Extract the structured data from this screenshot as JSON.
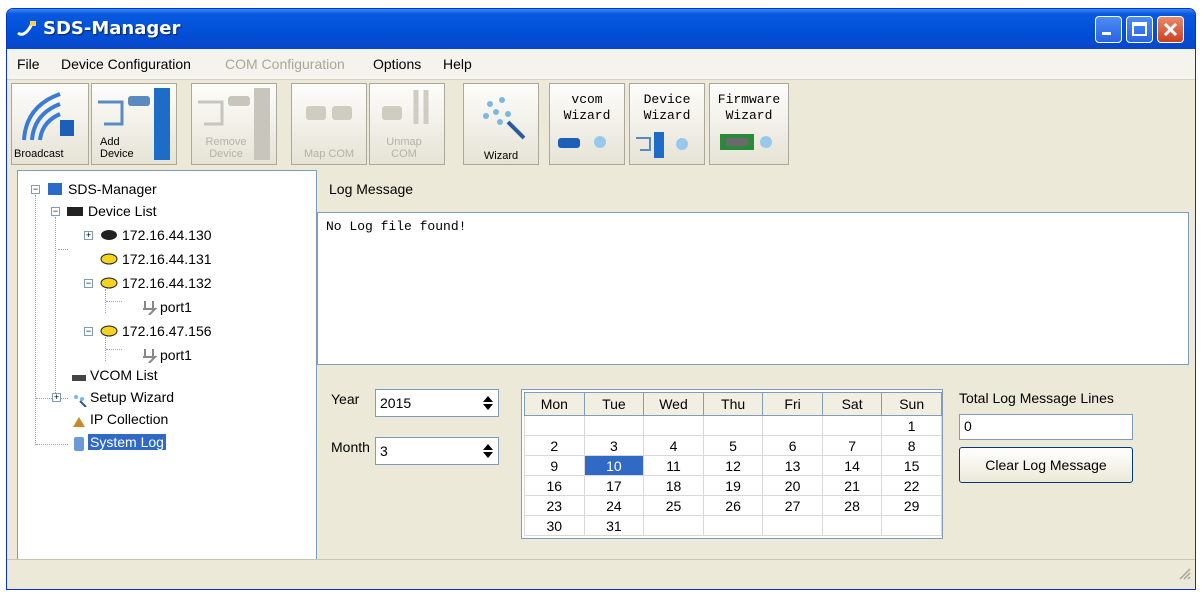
{
  "window": {
    "title": "SDS-Manager"
  },
  "menu": [
    {
      "label": "File",
      "enabled": true
    },
    {
      "label": "Device Configuration",
      "enabled": true
    },
    {
      "label": "COM Configuration",
      "enabled": false
    },
    {
      "label": "Options",
      "enabled": true
    },
    {
      "label": "Help",
      "enabled": true
    }
  ],
  "toolbar": {
    "broadcast": "Broadcast",
    "add_device": "Add Device",
    "remove_device": "Remove Device",
    "map_com": "Map COM",
    "unmap_com": "Unmap COM",
    "wizard": "Wizard",
    "vcom_wizard": [
      "vcom",
      "Wizard"
    ],
    "device_wizard": [
      "Device",
      "Wizard"
    ],
    "firmware_wizard": [
      "Firmware",
      "Wizard"
    ]
  },
  "tree": {
    "root": "SDS-Manager",
    "device_list": "Device List",
    "devices": [
      "172.16.44.130",
      "172.16.44.131",
      "172.16.44.132",
      "172.16.47.156"
    ],
    "port": "port1",
    "vcom_list": "VCOM List",
    "setup_wizard": "Setup Wizard",
    "ip_collection": "IP Collection",
    "system_log": "System Log"
  },
  "log": {
    "label": "Log Message",
    "content": "No Log file found!"
  },
  "date": {
    "year_label": "Year",
    "year": "2015",
    "month_label": "Month",
    "month": "3"
  },
  "calendar": {
    "days": [
      "Mon",
      "Tue",
      "Wed",
      "Thu",
      "Fri",
      "Sat",
      "Sun"
    ],
    "weeks": [
      [
        "",
        "",
        "",
        "",
        "",
        "",
        "1"
      ],
      [
        "2",
        "3",
        "4",
        "5",
        "6",
        "7",
        "8"
      ],
      [
        "9",
        "10",
        "11",
        "12",
        "13",
        "14",
        "15"
      ],
      [
        "16",
        "17",
        "18",
        "19",
        "20",
        "21",
        "22"
      ],
      [
        "23",
        "24",
        "25",
        "26",
        "27",
        "28",
        "29"
      ],
      [
        "30",
        "31",
        "",
        "",
        "",
        "",
        ""
      ]
    ],
    "selected": "10"
  },
  "total": {
    "label": "Total Log Message Lines",
    "value": "0"
  },
  "clear_button": "Clear Log Message"
}
